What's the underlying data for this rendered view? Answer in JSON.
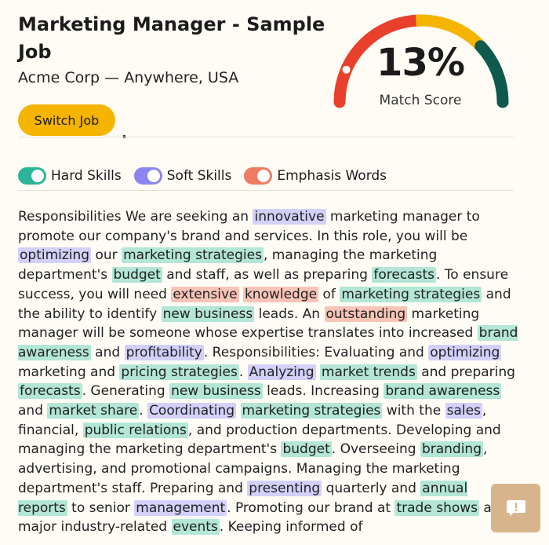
{
  "job": {
    "title": "Marketing Manager - Sample Job",
    "company_location": "Acme Corp — Anywhere, USA",
    "switch_label": "Switch Job"
  },
  "match": {
    "score_text": "13%",
    "score_value": 13,
    "label": "Match Score",
    "colors": [
      "#e8402a",
      "#f4b400",
      "#0f5a4c"
    ]
  },
  "toggles": [
    {
      "label": "Hard Skills",
      "color": "#2bb596",
      "on": true
    },
    {
      "label": "Soft Skills",
      "color": "#8b85f0",
      "on": true
    },
    {
      "label": "Emphasis Words",
      "color": "#f07b62",
      "on": true
    }
  ],
  "description": [
    {
      "t": "Responsibilities We are seeking an "
    },
    {
      "t": "innovative",
      "k": "soft"
    },
    {
      "t": " marketing manager to promote our company's brand and services. In this role, you will be "
    },
    {
      "t": "optimizing",
      "k": "soft"
    },
    {
      "t": " our "
    },
    {
      "t": "marketing strategies",
      "k": "hard"
    },
    {
      "t": ", managing the marketing department's "
    },
    {
      "t": "budget",
      "k": "hard"
    },
    {
      "t": " and staff, as well as preparing "
    },
    {
      "t": "forecasts",
      "k": "hard"
    },
    {
      "t": ". To ensure success, you will need "
    },
    {
      "t": "extensive",
      "k": "emph"
    },
    {
      "t": " "
    },
    {
      "t": "knowledge",
      "k": "emph"
    },
    {
      "t": " of "
    },
    {
      "t": "marketing strategies",
      "k": "hard"
    },
    {
      "t": " and the ability to identify "
    },
    {
      "t": "new business",
      "k": "hard"
    },
    {
      "t": " leads. An "
    },
    {
      "t": "outstanding",
      "k": "emph"
    },
    {
      "t": " marketing manager will be someone whose expertise translates into increased "
    },
    {
      "t": "brand awareness",
      "k": "hard"
    },
    {
      "t": " and "
    },
    {
      "t": "profitability",
      "k": "soft"
    },
    {
      "t": ". Responsibilities: Evaluating and "
    },
    {
      "t": "optimizing",
      "k": "soft"
    },
    {
      "t": " marketing and "
    },
    {
      "t": "pricing strategies",
      "k": "hard"
    },
    {
      "t": ". "
    },
    {
      "t": "Analyzing",
      "k": "soft"
    },
    {
      "t": " "
    },
    {
      "t": "market trends",
      "k": "hard"
    },
    {
      "t": " and preparing "
    },
    {
      "t": "forecasts",
      "k": "hard"
    },
    {
      "t": ". Generating "
    },
    {
      "t": "new business",
      "k": "hard"
    },
    {
      "t": " leads. Increasing "
    },
    {
      "t": "brand awareness",
      "k": "hard"
    },
    {
      "t": " and "
    },
    {
      "t": "market share",
      "k": "hard"
    },
    {
      "t": ". "
    },
    {
      "t": "Coordinating",
      "k": "soft"
    },
    {
      "t": " "
    },
    {
      "t": "marketing strategies",
      "k": "hard"
    },
    {
      "t": " with the "
    },
    {
      "t": "sales",
      "k": "soft"
    },
    {
      "t": ", financial, "
    },
    {
      "t": "public relations",
      "k": "hard"
    },
    {
      "t": ", and production departments. Developing and managing the marketing department's "
    },
    {
      "t": "budget",
      "k": "hard"
    },
    {
      "t": ". Overseeing "
    },
    {
      "t": "branding",
      "k": "hard"
    },
    {
      "t": ", advertising, and promotional campaigns. Managing the marketing department's staff. Preparing and "
    },
    {
      "t": "presenting",
      "k": "soft"
    },
    {
      "t": " quarterly and "
    },
    {
      "t": "annual reports",
      "k": "hard"
    },
    {
      "t": " to senior "
    },
    {
      "t": "management",
      "k": "soft"
    },
    {
      "t": ". Promoting our brand at "
    },
    {
      "t": "trade shows",
      "k": "hard"
    },
    {
      "t": " and major industry-related "
    },
    {
      "t": "events",
      "k": "hard"
    },
    {
      "t": ". Keeping informed of"
    }
  ],
  "feedback": {
    "icon": "feedback-icon"
  }
}
